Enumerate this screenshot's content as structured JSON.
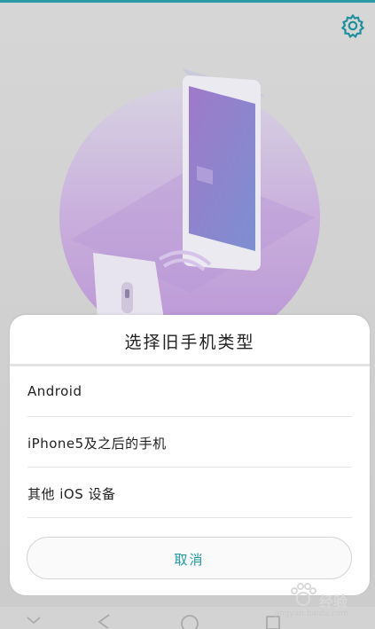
{
  "sheet": {
    "title": "选择旧手机类型",
    "options": [
      {
        "label": "Android"
      },
      {
        "label": "iPhone5及之后的手机"
      },
      {
        "label": "其他 iOS 设备"
      }
    ],
    "cancel_label": "取消"
  },
  "colors": {
    "accent": "#1f9aa8",
    "top_strip": "#2c9aa8",
    "backdrop": "#cfcfcf",
    "sheet_bg": "#ffffff"
  },
  "icons": {
    "settings": "gear-icon",
    "nav_down": "chevron-down-icon",
    "nav_back": "back-triangle-icon",
    "nav_home": "home-circle-icon",
    "nav_recent": "recent-square-icon"
  },
  "watermark": {
    "brand": "Bai",
    "text": "经验",
    "url": "jingyan.baidu.com"
  }
}
